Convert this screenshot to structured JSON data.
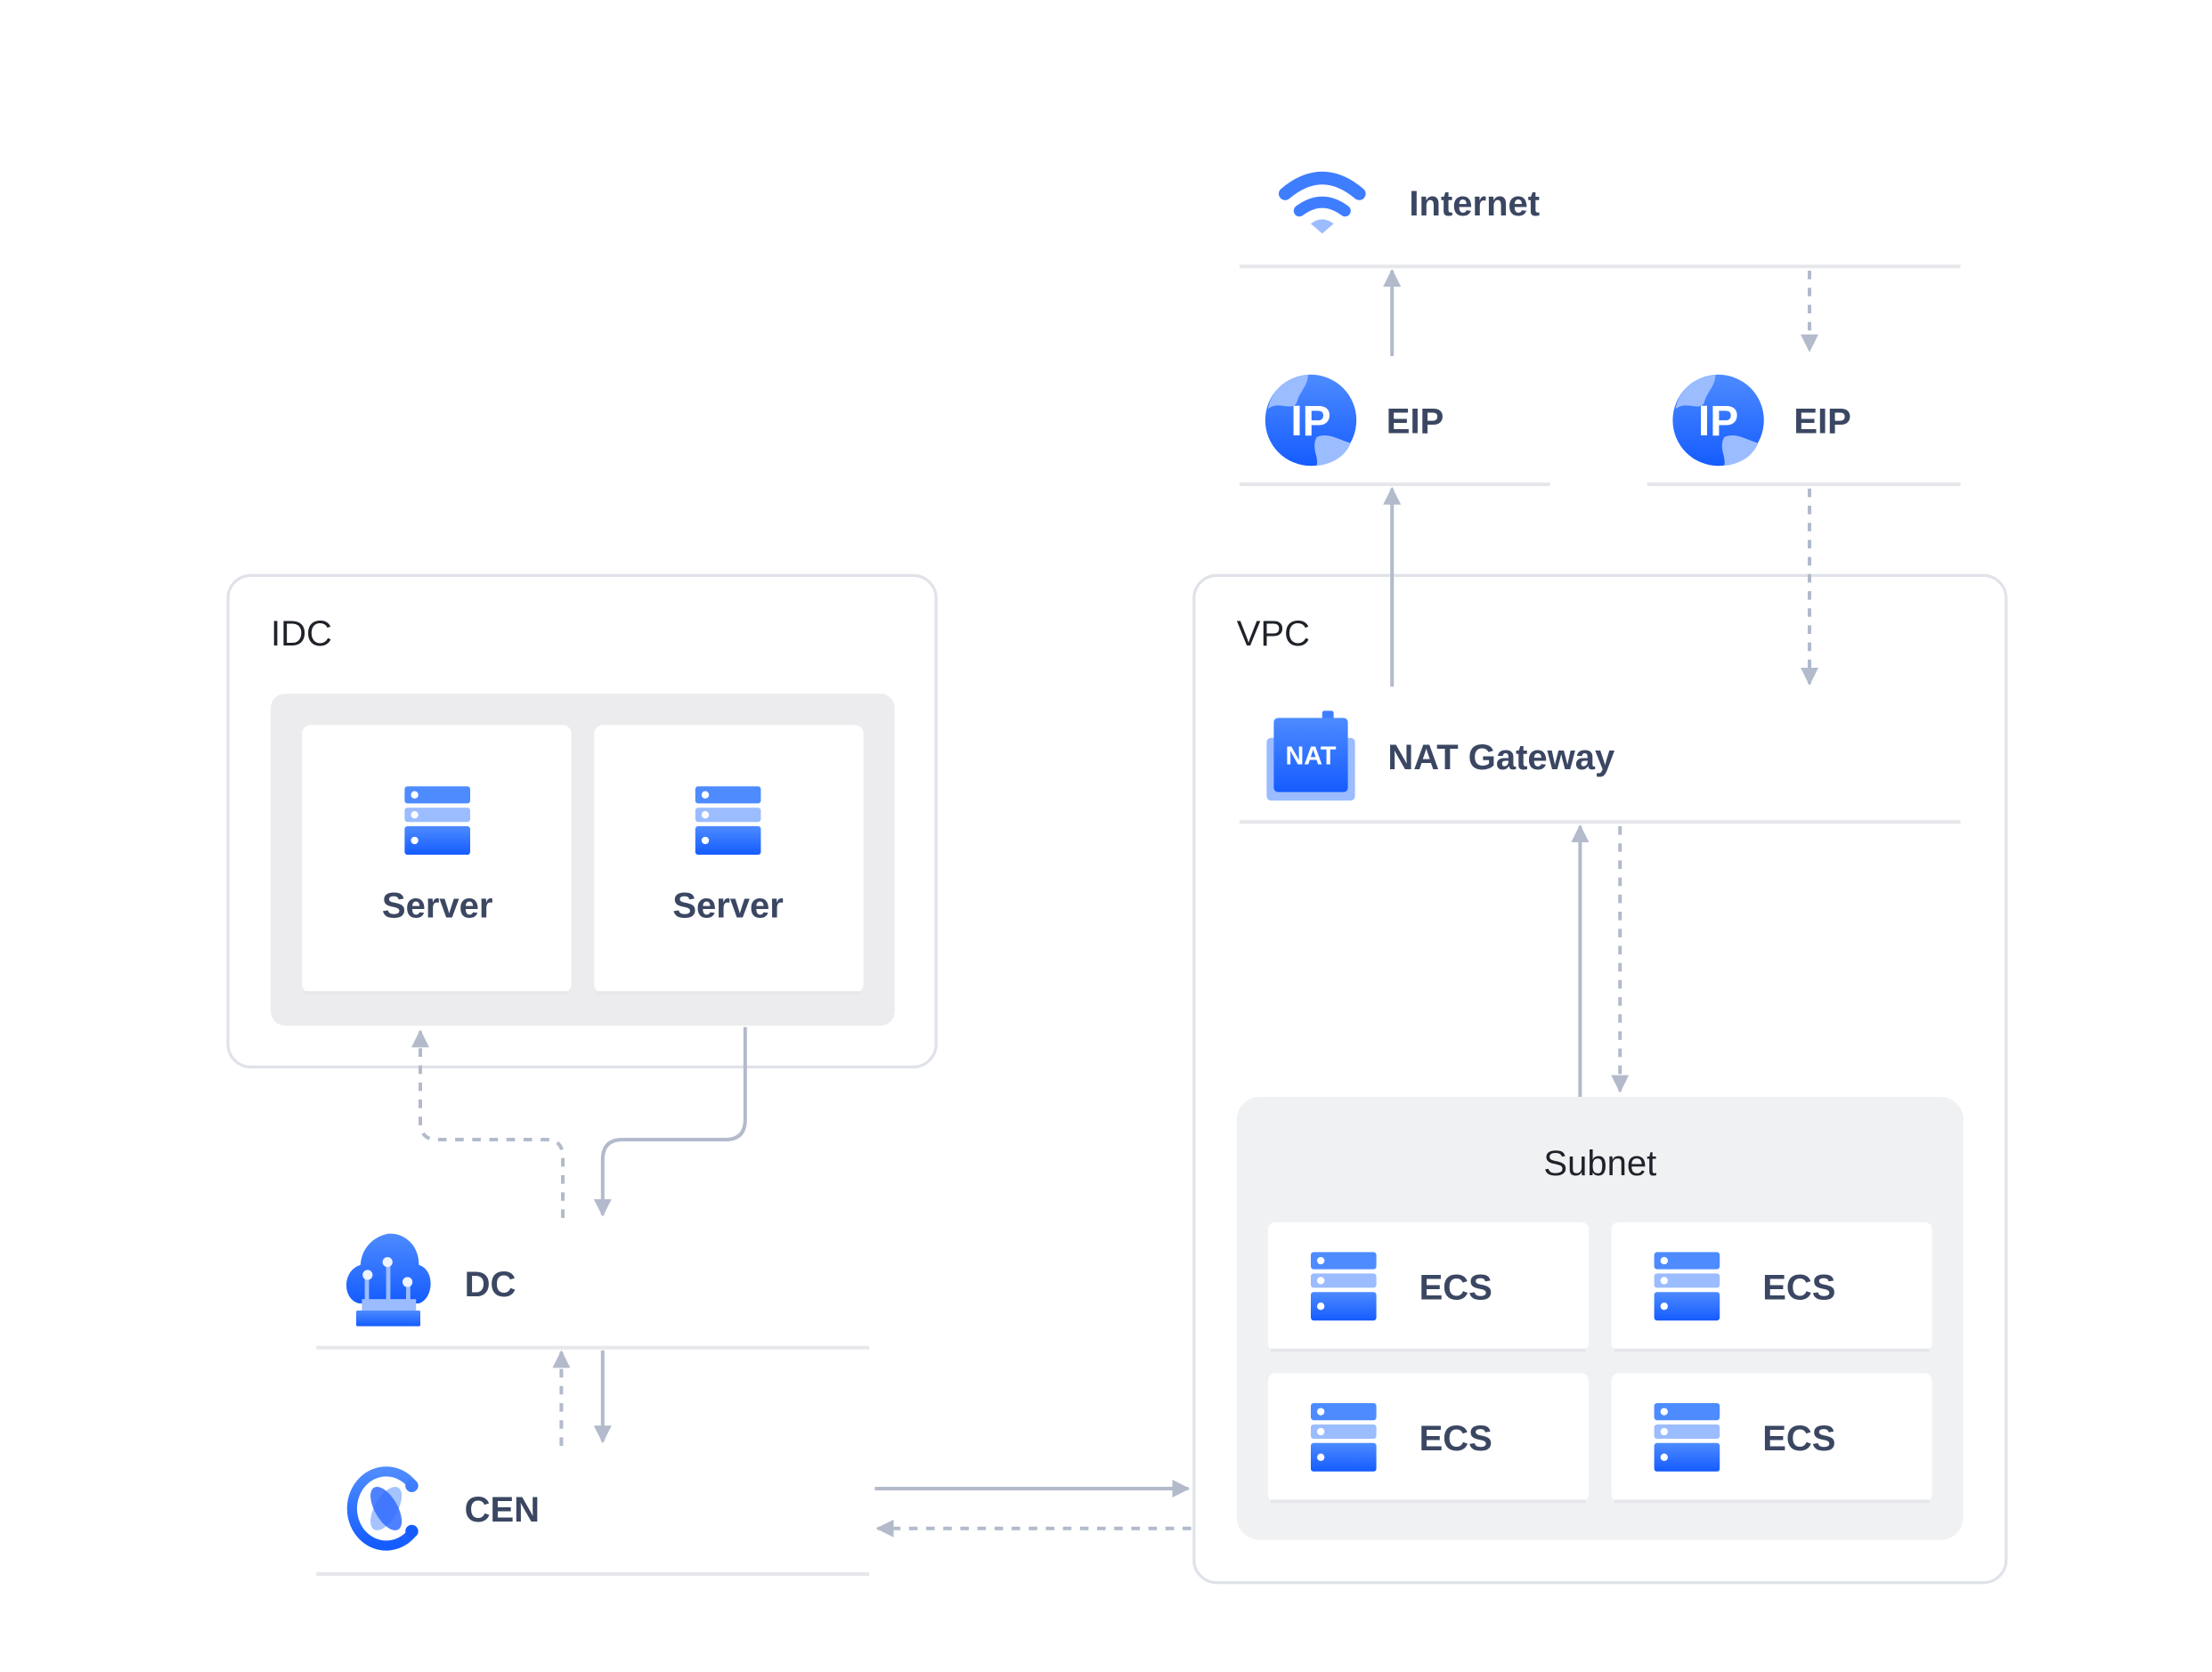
{
  "colors": {
    "accent": "#2f6bff",
    "accent_light": "#9bbcff",
    "edge": "#b2bacb",
    "text": "#3b4762"
  },
  "internet": {
    "label": "Internet",
    "icon": "wifi-icon"
  },
  "eips": [
    {
      "label": "EIP",
      "icon": "ip-globe-icon"
    },
    {
      "label": "EIP",
      "icon": "ip-globe-icon"
    }
  ],
  "vpc": {
    "label": "VPC",
    "nat": {
      "label": "NAT Gateway",
      "icon_text": "NAT"
    },
    "subnet": {
      "label": "Subnet",
      "ecs": [
        {
          "label": "ECS"
        },
        {
          "label": "ECS"
        },
        {
          "label": "ECS"
        },
        {
          "label": "ECS"
        }
      ]
    }
  },
  "idc": {
    "label": "IDC",
    "servers": [
      {
        "label": "Server"
      },
      {
        "label": "Server"
      }
    ]
  },
  "dc": {
    "label": "DC",
    "icon": "cloud-dc-icon"
  },
  "cen": {
    "label": "CEN",
    "icon": "cen-icon"
  }
}
